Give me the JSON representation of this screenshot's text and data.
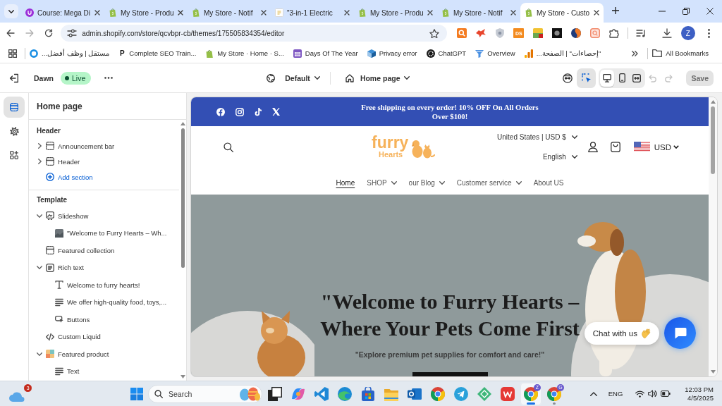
{
  "browser": {
    "tabs": [
      {
        "kind": "course",
        "title": "Course: Mega Di",
        "selected": false
      },
      {
        "kind": "store",
        "title": "My Store - Produ",
        "selected": false
      },
      {
        "kind": "store",
        "title": "My Store - Notif",
        "selected": false
      },
      {
        "kind": "document",
        "title": "\"3-in-1 Electric",
        "selected": false
      },
      {
        "kind": "store",
        "title": "My Store - Produ",
        "selected": false
      },
      {
        "kind": "store",
        "title": "My Store - Notif",
        "selected": false
      },
      {
        "kind": "store",
        "title": "My Store - Custo",
        "selected": true
      }
    ],
    "forward_disabled": true,
    "address": "admin.shopify.com/store/qcvbpr-cb/themes/175505834354/editor",
    "extension_label": "DS",
    "profile_initial": "Z",
    "bookmarks": [
      {
        "kind": "ring",
        "label": "مستقل | وظف أفضل..."
      },
      {
        "kind": "letter",
        "badge": "P",
        "label": "Complete SEO Train..."
      },
      {
        "kind": "store",
        "label": "My Store · Home · S..."
      },
      {
        "kind": "calendar",
        "label": "Days Of The Year"
      },
      {
        "kind": "cube",
        "label": "Privacy error"
      },
      {
        "kind": "chatgpt",
        "label": "ChatGPT"
      },
      {
        "kind": "funnel",
        "label": "Overview"
      },
      {
        "kind": "analytics",
        "label": "\"إحصاءات\" | الصفحة..."
      }
    ],
    "bookmarks_folder": "All Bookmarks"
  },
  "editor": {
    "theme": "Dawn",
    "status": "Live",
    "template": "Default",
    "page": "Home page",
    "inspector_on": true,
    "devices": [
      {
        "kind": "desktop",
        "selected": true
      },
      {
        "kind": "mobile",
        "selected": false
      },
      {
        "kind": "fullwidth",
        "selected": false
      }
    ],
    "undo_disabled": true,
    "redo_disabled": true,
    "save": {
      "label": "Save",
      "disabled": true
    },
    "rail": [
      {
        "kind": "sections",
        "selected": true
      },
      {
        "kind": "settings",
        "selected": false
      },
      {
        "kind": "apps",
        "selected": false
      }
    ],
    "sidebar": {
      "title": "Home page",
      "groups": [
        {
          "title": "Header",
          "items": [
            {
              "kind": "layout",
              "label": "Announcement bar",
              "expanded": false
            },
            {
              "kind": "layout",
              "label": "Header",
              "expanded": false
            }
          ],
          "add_label": "Add section"
        },
        {
          "title": "Template",
          "items": [
            {
              "kind": "slideshow",
              "label": "Slideshow",
              "expanded": true,
              "children": [
                {
                  "kind": "image",
                  "label": "\"Welcome to Furry Hearts – Wh..."
                }
              ]
            },
            {
              "kind": "layout",
              "label": "Featured collection"
            },
            {
              "kind": "richtext",
              "label": "Rich text",
              "expanded": true,
              "children": [
                {
                  "kind": "heading",
                  "label": "Welcome to furry hearts!"
                },
                {
                  "kind": "paragraph",
                  "label": "We offer high-quality food, toys,..."
                },
                {
                  "kind": "button",
                  "label": "Buttons"
                }
              ]
            },
            {
              "kind": "code",
              "label": "Custom Liquid"
            },
            {
              "kind": "product",
              "label": "Featured product",
              "expanded": true,
              "children": [
                {
                  "kind": "paragraph",
                  "label": "Text"
                }
              ]
            }
          ]
        }
      ]
    }
  },
  "preview": {
    "announcement": "Free shipping on every order! 10% OFF On All Orders Over $100!",
    "logo": {
      "word1": "furry",
      "word2": "Hearts"
    },
    "country": "United States | USD $",
    "language": "English",
    "currency": "USD",
    "nav": [
      {
        "label": "Home",
        "selected": true,
        "dropdown": false
      },
      {
        "label": "SHOP",
        "selected": false,
        "dropdown": true
      },
      {
        "label": "our Blog",
        "selected": false,
        "dropdown": true
      },
      {
        "label": "Customer service",
        "selected": false,
        "dropdown": true
      },
      {
        "label": "About US",
        "selected": false,
        "dropdown": false
      }
    ],
    "hero": {
      "heading_lines": [
        "\"Welcome to Furry Hearts –",
        "Where Your Pets Come First"
      ],
      "subheading": "\"Explore premium pet supplies for comfort and care!\""
    },
    "chat_label": "Chat with us"
  },
  "taskbar": {
    "weather_badge": "3",
    "search_placeholder": "Search",
    "apps": [
      {
        "kind": "taskview",
        "selected": false,
        "running": false
      },
      {
        "kind": "copilot",
        "selected": false,
        "running": false
      },
      {
        "kind": "vscode",
        "selected": false,
        "running": false
      },
      {
        "kind": "edge",
        "selected": false,
        "running": false
      },
      {
        "kind": "store",
        "selected": false,
        "running": false
      },
      {
        "kind": "files",
        "selected": false,
        "running": false
      },
      {
        "kind": "outlook",
        "selected": false,
        "running": false
      },
      {
        "kind": "chrome",
        "selected": false,
        "running": false
      },
      {
        "kind": "telegram",
        "selected": false,
        "running": false
      },
      {
        "kind": "diamond",
        "selected": false,
        "running": false
      },
      {
        "kind": "wps",
        "selected": false,
        "running": false
      },
      {
        "kind": "chrome",
        "badge": "Z",
        "selected": true,
        "running": true
      },
      {
        "kind": "chrome",
        "badge": "G",
        "selected": false,
        "running": true
      }
    ],
    "language": "ENG",
    "time": "12:03 PM",
    "date": "4/5/2025"
  }
}
